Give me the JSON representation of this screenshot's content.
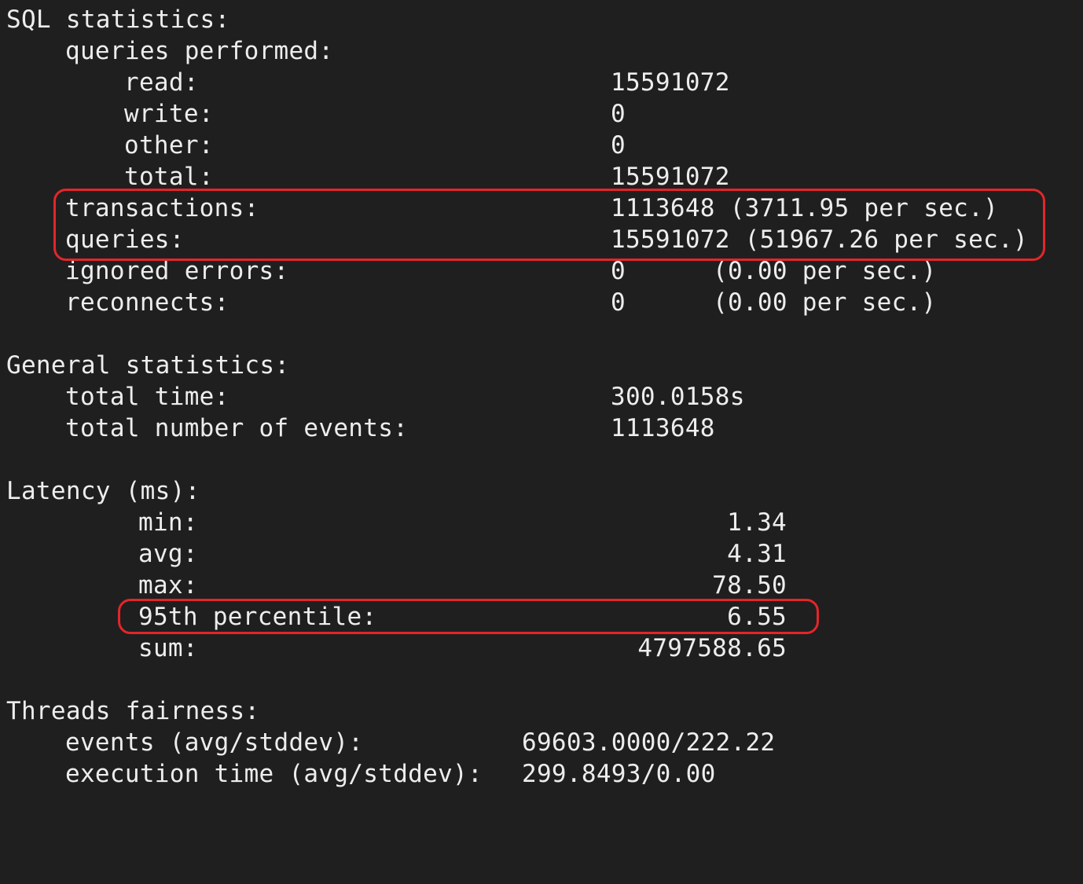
{
  "sql": {
    "heading": "SQL statistics:",
    "queries_performed_label": "queries performed:",
    "read_label": "read:",
    "read_value": "15591072",
    "write_label": "write:",
    "write_value": "0",
    "other_label": "other:",
    "other_value": "0",
    "total_label": "total:",
    "total_value": "15591072",
    "transactions_label": "transactions:",
    "transactions_value": "1113648 (3711.95 per sec.)",
    "queries_label": "queries:",
    "queries_value": "15591072 (51967.26 per sec.)",
    "ignored_errors_label": "ignored errors:",
    "ignored_errors_value": "0",
    "ignored_errors_rate": "(0.00 per sec.)",
    "reconnects_label": "reconnects:",
    "reconnects_value": "0",
    "reconnects_rate": "(0.00 per sec.)"
  },
  "general": {
    "heading": "General statistics:",
    "total_time_label": "total time:",
    "total_time_value": "300.0158s",
    "total_events_label": "total number of events:",
    "total_events_value": "1113648"
  },
  "latency": {
    "heading": "Latency (ms):",
    "min_label": "min:",
    "min_value": "1.34",
    "avg_label": "avg:",
    "avg_value": "4.31",
    "max_label": "max:",
    "max_value": "78.50",
    "p95_label": "95th percentile:",
    "p95_value": "6.55",
    "sum_label": "sum:",
    "sum_value": "4797588.65"
  },
  "threads": {
    "heading": "Threads fairness:",
    "events_label": "events (avg/stddev):",
    "events_value": "69603.0000/222.22",
    "exec_time_label": "execution time (avg/stddev):",
    "exec_time_value": "299.8493/0.00"
  },
  "colors": {
    "background": "#1f1f1f",
    "text": "#ededed",
    "highlight_border": "#e3262a"
  }
}
